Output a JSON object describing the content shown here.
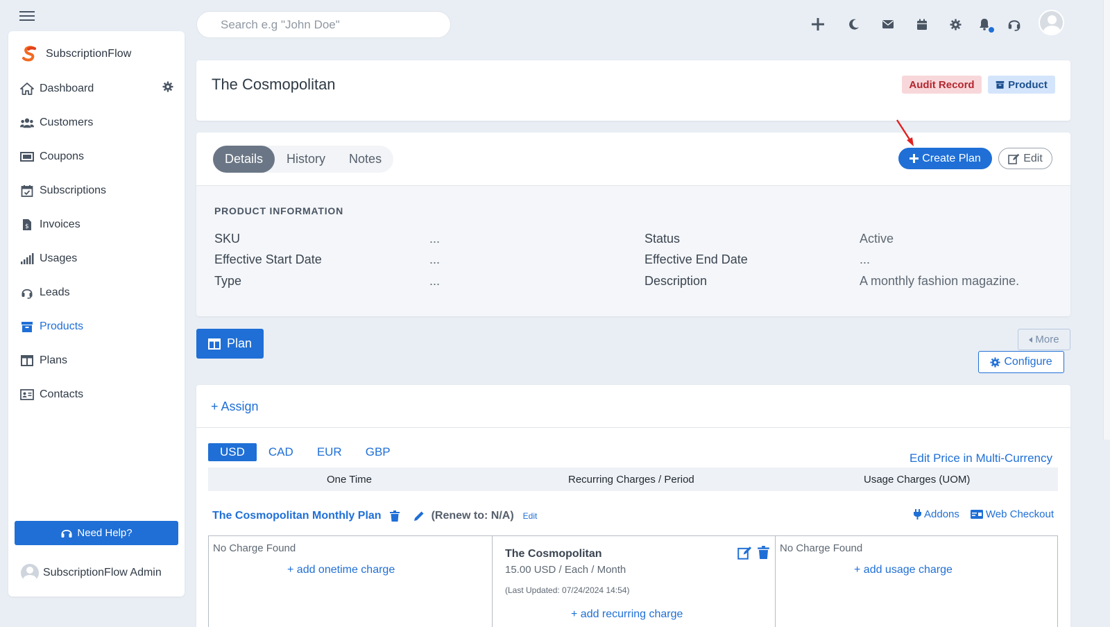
{
  "brand": {
    "name": "SubscriptionFlow",
    "accent": "#1f6fd6"
  },
  "sidebar": {
    "items": [
      {
        "label": "Dashboard",
        "icon": "home-icon"
      },
      {
        "label": "Customers",
        "icon": "users-icon"
      },
      {
        "label": "Coupons",
        "icon": "ticket-icon"
      },
      {
        "label": "Subscriptions",
        "icon": "calendar-check-icon"
      },
      {
        "label": "Invoices",
        "icon": "invoice-icon"
      },
      {
        "label": "Usages",
        "icon": "signal-icon"
      },
      {
        "label": "Leads",
        "icon": "headset-icon"
      },
      {
        "label": "Products",
        "icon": "archive-icon",
        "active": true
      },
      {
        "label": "Plans",
        "icon": "columns-icon"
      },
      {
        "label": "Contacts",
        "icon": "id-card-icon"
      }
    ],
    "help_label": "Need Help?",
    "admin_label": "SubscriptionFlow Admin"
  },
  "header": {
    "search_placeholder": "Search e.g \"John Doe\""
  },
  "title_card": {
    "title": "The Cosmopolitan",
    "audit_label": "Audit Record",
    "product_label": "Product"
  },
  "details": {
    "tabs": [
      "Details",
      "History",
      "Notes"
    ],
    "active_tab": "Details",
    "create_plan_label": "Create Plan",
    "edit_label": "Edit",
    "section_title": "PRODUCT INFORMATION",
    "fields": {
      "sku": {
        "label": "SKU",
        "value": "..."
      },
      "start": {
        "label": "Effective Start Date",
        "value": "..."
      },
      "type": {
        "label": "Type",
        "value": "..."
      },
      "status": {
        "label": "Status",
        "value": "Active"
      },
      "end": {
        "label": "Effective End Date",
        "value": "..."
      },
      "description": {
        "label": "Description",
        "value": "A monthly fashion magazine."
      }
    }
  },
  "plan_section": {
    "plan_button": "Plan",
    "more_label": "More",
    "configure_label": "Configure",
    "assign_label": "+ Assign",
    "currencies": [
      "USD",
      "CAD",
      "EUR",
      "GBP"
    ],
    "active_currency": "USD",
    "edit_multi_label": "Edit Price in Multi-Currency",
    "columns": [
      "One Time",
      "Recurring Charges / Period",
      "Usage Charges (UOM)"
    ],
    "plan_name": "The Cosmopolitan Monthly Plan",
    "renew_text": "(Renew to: N/A)",
    "plan_edit_link": "Edit",
    "addons_label": "Addons",
    "web_checkout_label": "Web Checkout",
    "onetime": {
      "empty": "No Charge Found",
      "add": "+ add onetime charge"
    },
    "recurring": {
      "name": "The Cosmopolitan",
      "price": "15.00 USD / Each / Month",
      "updated": "(Last Updated: 07/24/2024 14:54)",
      "add": "+ add recurring charge"
    },
    "usage": {
      "empty": "No Charge Found",
      "add": "+ add usage charge"
    }
  }
}
